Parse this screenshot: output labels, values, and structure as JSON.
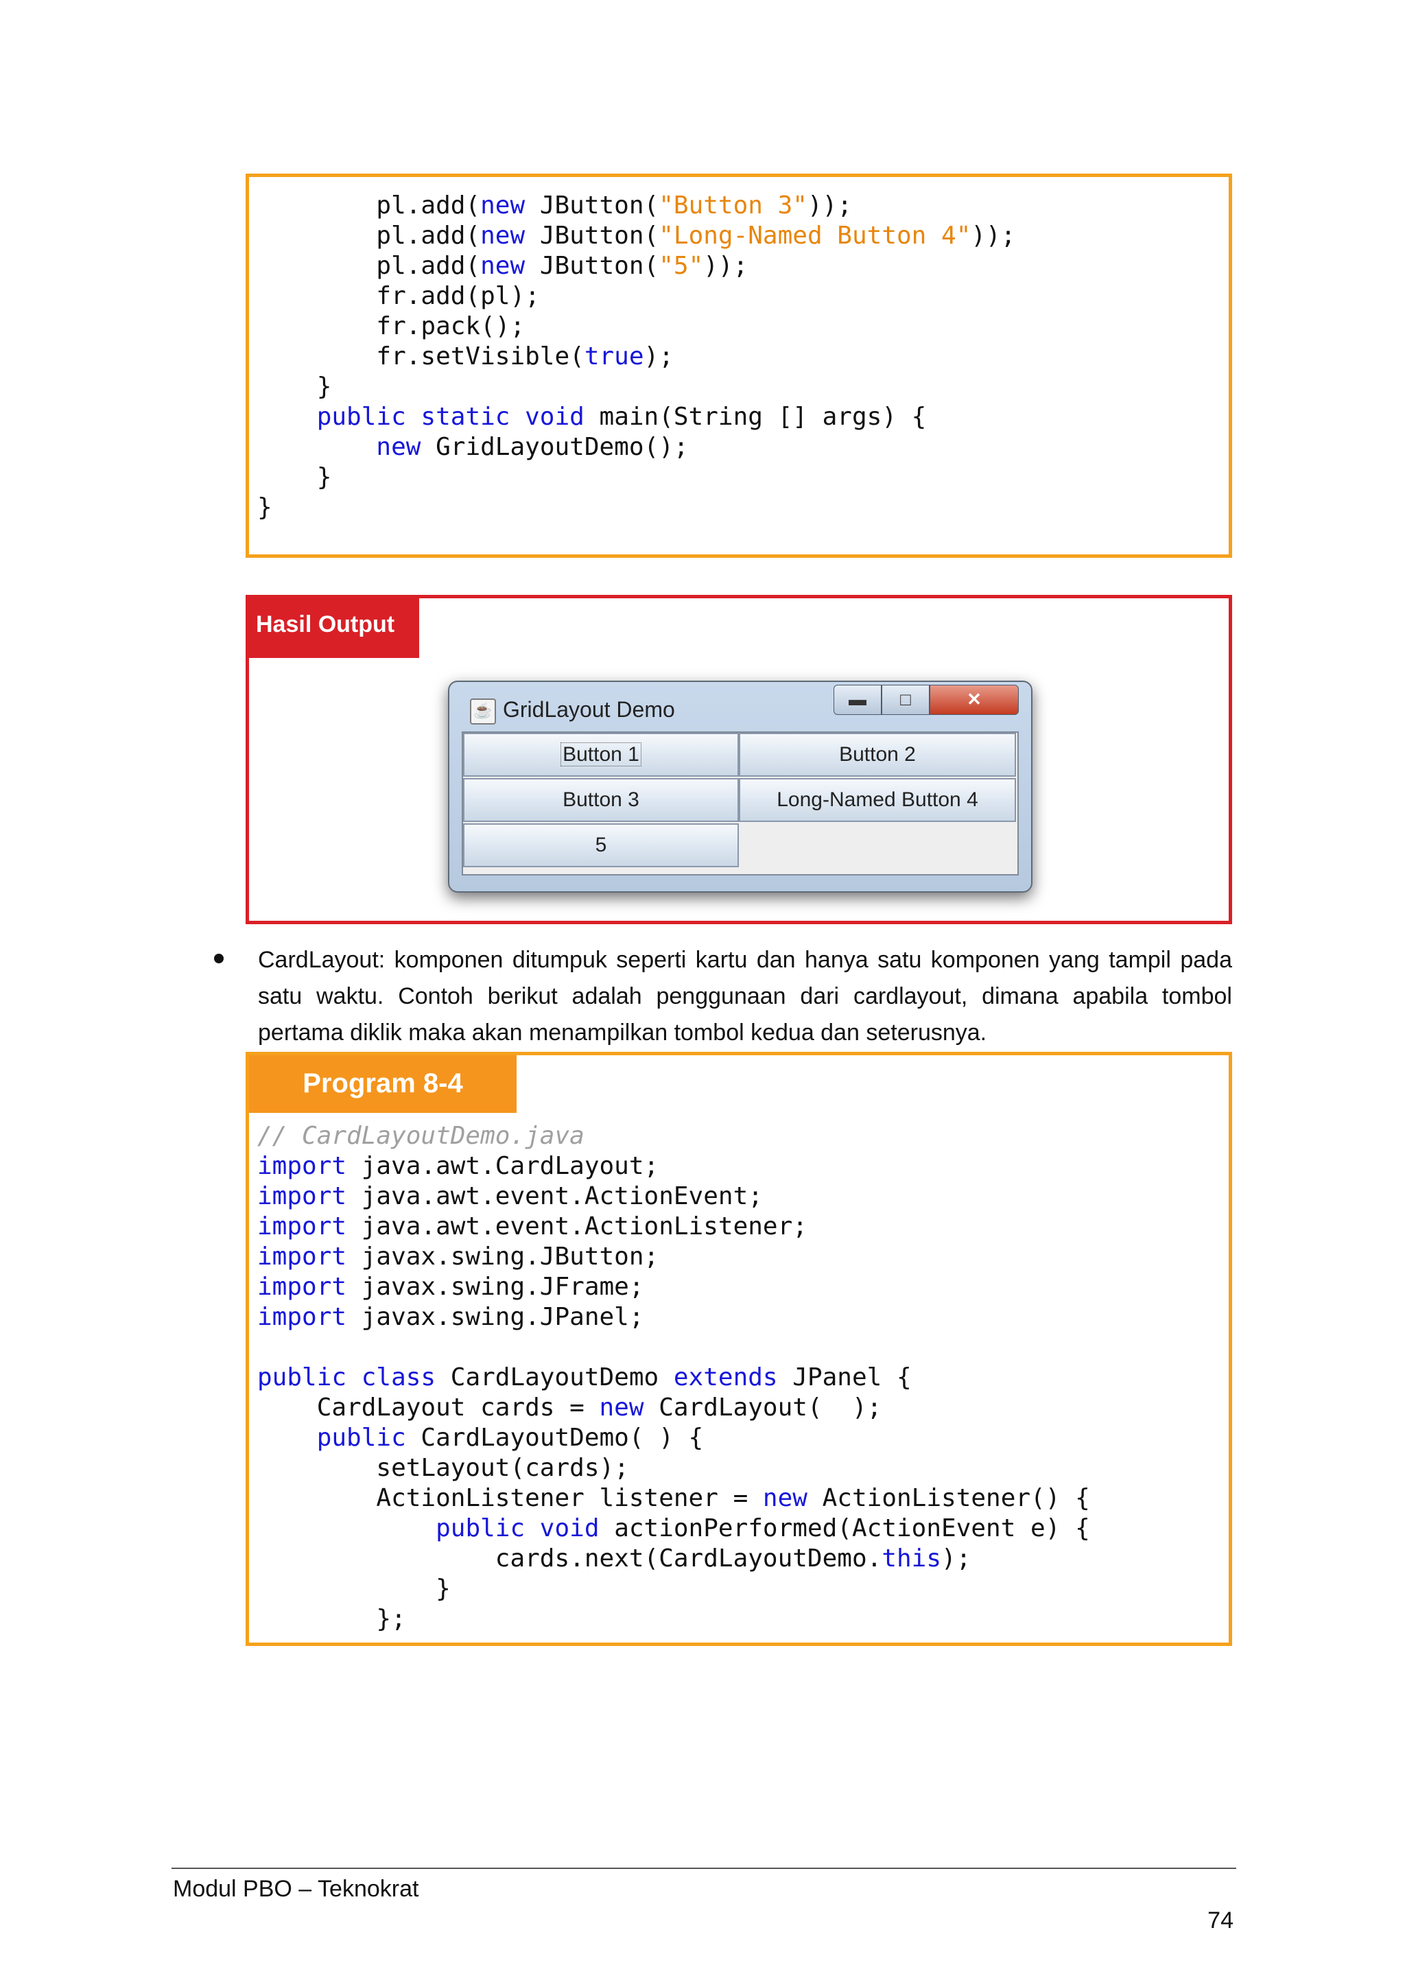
{
  "code_block_1": {
    "lines": [
      [
        {
          "t": "        pl.add("
        },
        {
          "t": "new",
          "k": "kw"
        },
        {
          "t": " JButton("
        },
        {
          "t": "\"Button 3\"",
          "k": "str"
        },
        {
          "t": "));"
        }
      ],
      [
        {
          "t": "        pl.add("
        },
        {
          "t": "new",
          "k": "kw"
        },
        {
          "t": " JButton("
        },
        {
          "t": "\"Long-Named Button 4\"",
          "k": "str"
        },
        {
          "t": "));"
        }
      ],
      [
        {
          "t": "        pl.add("
        },
        {
          "t": "new",
          "k": "kw"
        },
        {
          "t": " JButton("
        },
        {
          "t": "\"5\"",
          "k": "str"
        },
        {
          "t": "));"
        }
      ],
      [
        {
          "t": "        fr.add(pl);"
        }
      ],
      [
        {
          "t": "        fr.pack();"
        }
      ],
      [
        {
          "t": "        fr.setVisible("
        },
        {
          "t": "true",
          "k": "kw"
        },
        {
          "t": ");"
        }
      ],
      [
        {
          "t": "    }"
        }
      ],
      [
        {
          "t": "    "
        },
        {
          "t": "public static void",
          "k": "kw"
        },
        {
          "t": " main(String [] args) {"
        }
      ],
      [
        {
          "t": "        "
        },
        {
          "t": "new",
          "k": "kw"
        },
        {
          "t": " GridLayoutDemo();"
        }
      ],
      [
        {
          "t": "    }"
        }
      ],
      [
        {
          "t": "}"
        }
      ]
    ]
  },
  "output": {
    "label": "Hasil Output",
    "window": {
      "title": "GridLayout Demo",
      "buttons": [
        "Button 1",
        "Button 2",
        "Button 3",
        "Long-Named Button 4",
        "5"
      ]
    }
  },
  "bullet": {
    "lines": [
      "CardLayout: komponen ditumpuk seperti kartu dan hanya satu komponen yang tampil pada",
      "satu waktu. Contoh berikut adalah penggunaan dari cardlayout, dimana apabila tombol",
      "pertama diklik maka akan menampilkan tombol kedua dan seterusnya."
    ]
  },
  "program": {
    "label": "Program 8-4",
    "lines": [
      [
        {
          "t": "// CardLayoutDemo.java",
          "k": "cm"
        }
      ],
      [
        {
          "t": "import",
          "k": "kw"
        },
        {
          "t": " java.awt.CardLayout;"
        }
      ],
      [
        {
          "t": "import",
          "k": "kw"
        },
        {
          "t": " java.awt.event.ActionEvent;"
        }
      ],
      [
        {
          "t": "import",
          "k": "kw"
        },
        {
          "t": " java.awt.event.ActionListener;"
        }
      ],
      [
        {
          "t": "import",
          "k": "kw"
        },
        {
          "t": " javax.swing.JButton;"
        }
      ],
      [
        {
          "t": "import",
          "k": "kw"
        },
        {
          "t": " javax.swing.JFrame;"
        }
      ],
      [
        {
          "t": "import",
          "k": "kw"
        },
        {
          "t": " javax.swing.JPanel;"
        }
      ],
      [
        {
          "t": ""
        }
      ],
      [
        {
          "t": "public class",
          "k": "kw"
        },
        {
          "t": " CardLayoutDemo "
        },
        {
          "t": "extends",
          "k": "kw"
        },
        {
          "t": " JPanel {"
        }
      ],
      [
        {
          "t": "    CardLayout cards = "
        },
        {
          "t": "new",
          "k": "kw"
        },
        {
          "t": " CardLayout(  );"
        }
      ],
      [
        {
          "t": "    "
        },
        {
          "t": "public",
          "k": "kw"
        },
        {
          "t": " CardLayoutDemo( ) {"
        }
      ],
      [
        {
          "t": "        setLayout(cards);"
        }
      ],
      [
        {
          "t": "        ActionListener listener = "
        },
        {
          "t": "new",
          "k": "kw"
        },
        {
          "t": " ActionListener() {"
        }
      ],
      [
        {
          "t": "            "
        },
        {
          "t": "public void",
          "k": "kw"
        },
        {
          "t": " actionPerformed(ActionEvent e) {"
        }
      ],
      [
        {
          "t": "                cards.next(CardLayoutDemo."
        },
        {
          "t": "this",
          "k": "kw"
        },
        {
          "t": ");"
        }
      ],
      [
        {
          "t": "            }"
        }
      ],
      [
        {
          "t": "        };"
        }
      ]
    ]
  },
  "footer": {
    "left": "Modul PBO – Teknokrat",
    "page_number": "74"
  }
}
